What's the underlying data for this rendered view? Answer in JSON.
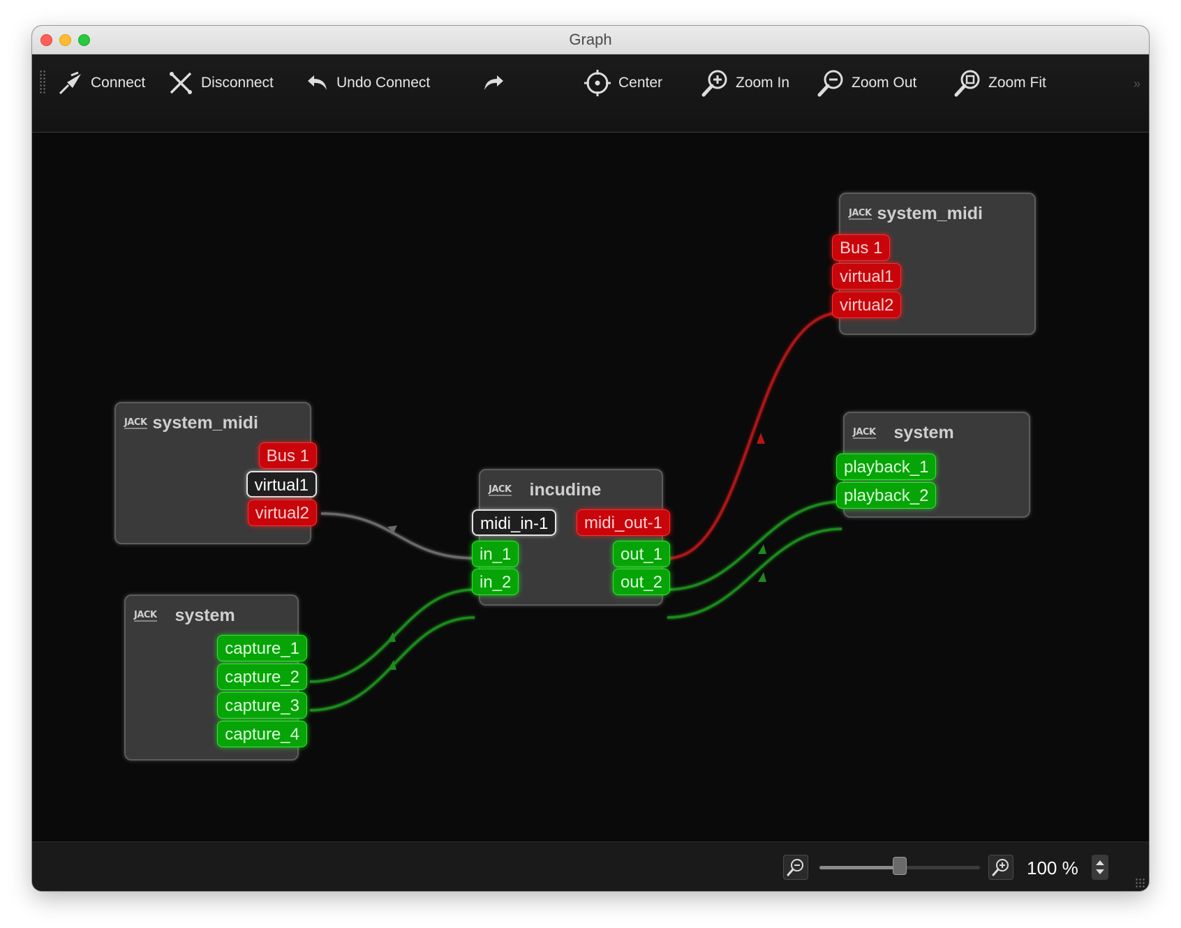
{
  "window": {
    "title": "Graph"
  },
  "toolbar": {
    "connect_label": "Connect",
    "disconnect_label": "Disconnect",
    "undo_label": "Undo Connect",
    "center_label": "Center",
    "zoom_in_label": "Zoom In",
    "zoom_out_label": "Zoom Out",
    "zoom_fit_label": "Zoom Fit",
    "more_label": "»"
  },
  "jack_logo": "JACK",
  "nodes": {
    "system_midi_left": {
      "title": "system_midi",
      "ports": [
        "Bus 1",
        "virtual1",
        "virtual2"
      ]
    },
    "system_left": {
      "title": "system",
      "ports": [
        "capture_1",
        "capture_2",
        "capture_3",
        "capture_4"
      ]
    },
    "incudine": {
      "title": "incudine",
      "inputs": [
        "midi_in-1",
        "in_1",
        "in_2"
      ],
      "outputs": [
        "midi_out-1",
        "out_1",
        "out_2"
      ]
    },
    "system_midi_right": {
      "title": "system_midi",
      "ports": [
        "Bus 1",
        "virtual1",
        "virtual2"
      ]
    },
    "system_right": {
      "title": "system",
      "ports": [
        "playback_1",
        "playback_2"
      ]
    }
  },
  "zoom": {
    "value": 100,
    "label": "100 %",
    "min": 0,
    "max": 200
  },
  "colors": {
    "midi_port": "#c8050a",
    "audio_port": "#07a407",
    "selected_port": "#e5e5e5",
    "midi_wire": "#b01818",
    "audio_wire": "#1f8a1f",
    "selected_wire": "#6a6a6a"
  },
  "icons": [
    "connect-icon",
    "disconnect-icon",
    "undo-icon",
    "redo-icon",
    "center-icon",
    "zoom-in-icon",
    "zoom-out-icon",
    "zoom-fit-icon",
    "jack-logo"
  ]
}
